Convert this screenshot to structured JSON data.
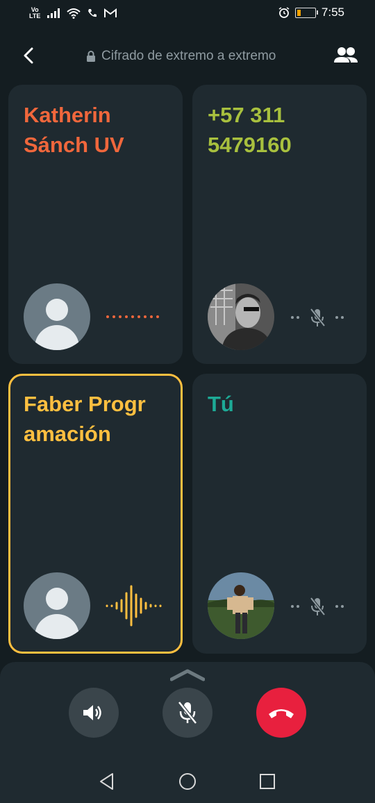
{
  "status_bar": {
    "network_label": "Vo LTE",
    "time": "7:55",
    "icons": [
      "volte-icon",
      "signal-icon",
      "wifi-icon",
      "phone-icon",
      "gmail-icon",
      "alarm-icon",
      "battery-icon"
    ]
  },
  "header": {
    "encryption_text": "Cifrado de extremo a extremo",
    "icons": [
      "back-arrow-icon",
      "lock-icon",
      "participants-icon"
    ]
  },
  "participants": [
    {
      "name": "Katherin Sánch UV",
      "color": "#f0673c",
      "status": "connecting",
      "avatar": "default"
    },
    {
      "name": "+57 311 5479160",
      "color": "#a8c03e",
      "status": "muted",
      "avatar": "photo"
    },
    {
      "name": "Faber Programación",
      "name_line1": "Faber Progr",
      "name_line2": "amación",
      "color": "#ffbf40",
      "status": "speaking",
      "avatar": "default"
    },
    {
      "name": "Tú",
      "color": "#1daa96",
      "status": "muted",
      "avatar": "photo"
    }
  ],
  "controls": [
    "speaker-button",
    "mute-button",
    "end-call-button"
  ],
  "colors": {
    "end_call": "#e8203e",
    "active_border": "#ffbf40",
    "tile_bg": "#1f2a30"
  }
}
